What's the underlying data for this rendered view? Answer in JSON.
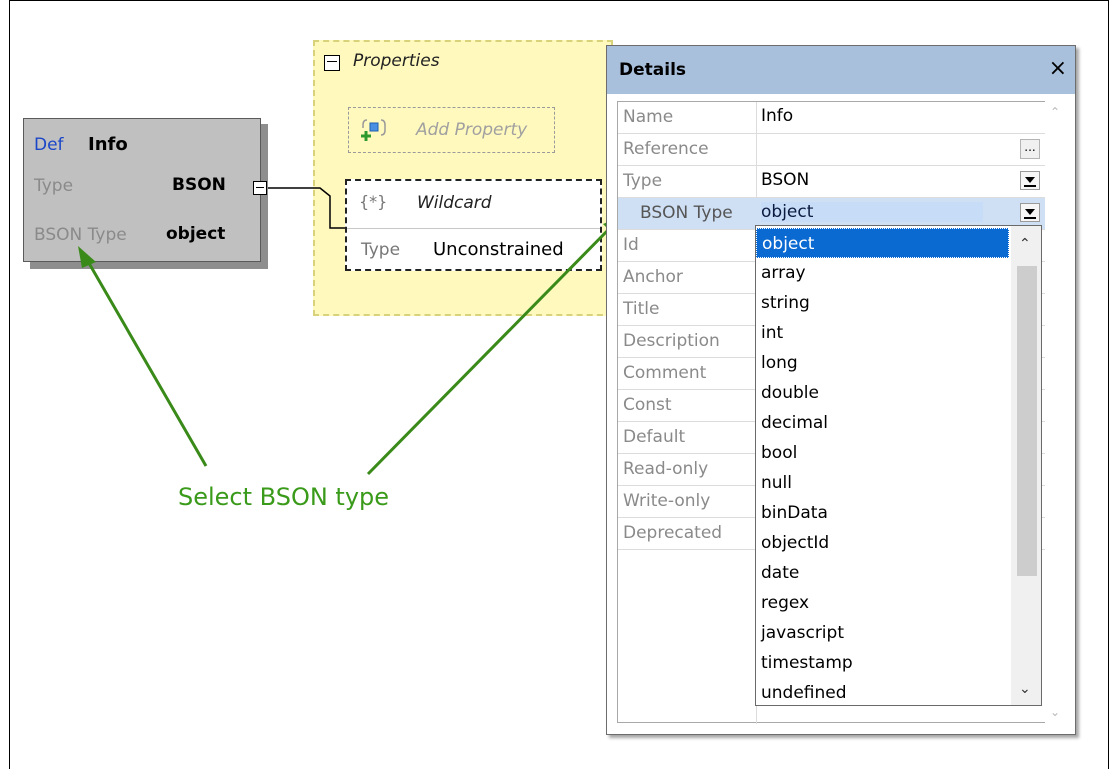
{
  "def_box": {
    "def_label": "Def",
    "title": "Info",
    "rows": [
      {
        "key": "Type",
        "value": "BSON"
      },
      {
        "key": "BSON Type",
        "value": "object"
      }
    ]
  },
  "properties": {
    "title": "Properties",
    "add_property": "Add Property",
    "wildcard": {
      "name": "Wildcard",
      "icon": "{*}",
      "type_key": "Type",
      "type_value": "Unconstrained"
    }
  },
  "details": {
    "title": "Details",
    "close": "×",
    "rows": [
      {
        "key": "Name",
        "value": "Info"
      },
      {
        "key": "Reference",
        "value": ""
      },
      {
        "key": "Type",
        "value": "BSON"
      },
      {
        "key": "BSON Type",
        "value": "object"
      },
      {
        "key": "Id",
        "value": ""
      },
      {
        "key": "Anchor",
        "value": ""
      },
      {
        "key": "Title",
        "value": ""
      },
      {
        "key": "Description",
        "value": ""
      },
      {
        "key": "Comment",
        "value": ""
      },
      {
        "key": "Const",
        "value": ""
      },
      {
        "key": "Default",
        "value": ""
      },
      {
        "key": "Read-only",
        "value": ""
      },
      {
        "key": "Write-only",
        "value": ""
      },
      {
        "key": "Deprecated",
        "value": ""
      }
    ],
    "ellipsis": "...",
    "dropdown_options": [
      "object",
      "array",
      "string",
      "int",
      "long",
      "double",
      "decimal",
      "bool",
      "null",
      "binData",
      "objectId",
      "date",
      "regex",
      "javascript",
      "timestamp",
      "undefined"
    ],
    "selected_option": "object"
  },
  "caption": "Select BSON type",
  "colors": {
    "accent": "#3a9a1a",
    "header": "#a9c0dc",
    "selection": "#0b69d2"
  }
}
